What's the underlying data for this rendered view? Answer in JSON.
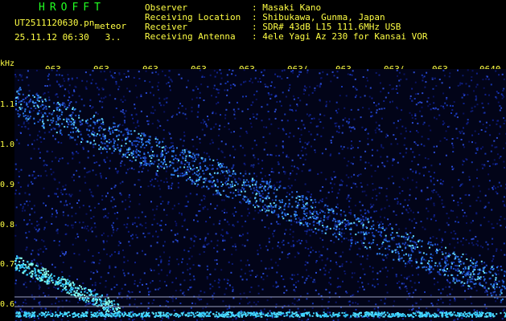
{
  "header": {
    "logo": "HROFFT",
    "filename_main": "UT2511120630.pn",
    "filename_sub": "meteor",
    "date": "25.11.12",
    "time": "06:30",
    "count": "3.."
  },
  "meta": [
    {
      "label": "Observer",
      "value": ": Masaki Kano"
    },
    {
      "label": "Receiving Location",
      "value": ": Shibukawa, Gunma, Japan"
    },
    {
      "label": "Receiver",
      "value": ": SDR# 43dB L15 111.6MHz USB"
    },
    {
      "label": "Receiving Antenna",
      "value": ": 4ele Yagi Az 230 for Kansai VOR"
    }
  ],
  "axis": {
    "unit": "kHz",
    "y_ticks": [
      "1.1",
      "1.0",
      "0.9",
      "0.8",
      "0.7",
      "0.6"
    ],
    "x_ticks": [
      "063",
      "063",
      "063",
      "063",
      "063",
      "063(",
      "063",
      "063(",
      "063",
      "0640"
    ]
  },
  "colors": {
    "header_text": "#ffff44",
    "logo": "#22ff22",
    "background": "#020418",
    "signal": "#33ccff"
  }
}
